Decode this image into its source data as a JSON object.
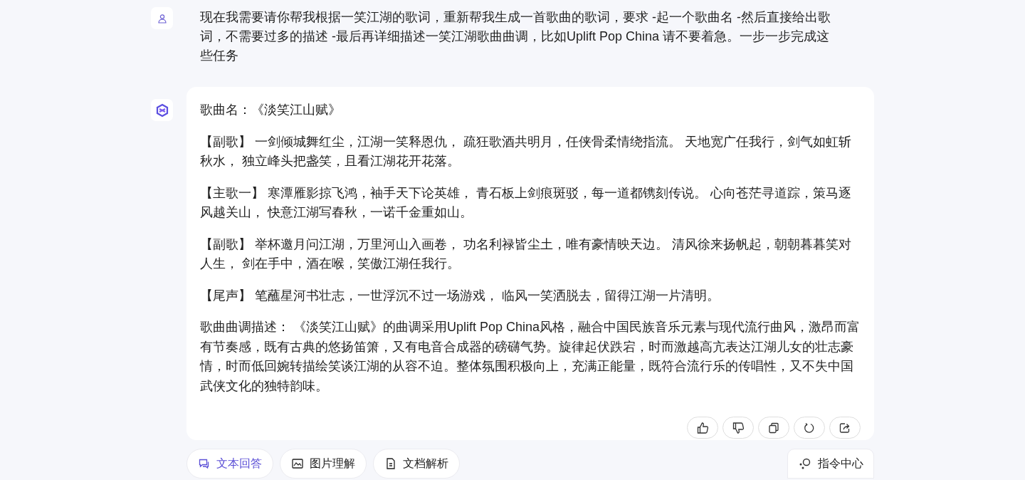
{
  "user_message": {
    "text": "现在我需要请你帮我根据一笑江湖的歌词，重新帮我生成一首歌曲的歌词，要求 -起一个歌曲名 -然后直接给出歌词，不需要过多的描述 -最后再详细描述一笑江湖歌曲曲调，比如Uplift Pop China 请不要着急。一步一步完成这些任务"
  },
  "assistant_message": {
    "paragraphs": [
      "歌曲名：《淡笑江山赋》",
      "【副歌】 一剑倾城舞红尘，江湖一笑释恩仇， 疏狂歌酒共明月，任侠骨柔情绕指流。 天地宽广任我行，剑气如虹斩秋水， 独立峰头把盏笑，且看江湖花开花落。",
      "【主歌一】 寒潭雁影掠飞鸿，袖手天下论英雄， 青石板上剑痕斑驳，每一道都镌刻传说。 心向苍茫寻道踪，策马逐风越关山， 快意江湖写春秋，一诺千金重如山。",
      "【副歌】 举杯邀月问江湖，万里河山入画卷， 功名利禄皆尘土，唯有豪情映天边。 清风徐来扬帆起，朝朝暮暮笑对人生， 剑在手中，酒在喉，笑傲江湖任我行。",
      "【尾声】 笔蘸星河书壮志，一世浮沉不过一场游戏， 临风一笑洒脱去，留得江湖一片清明。",
      "歌曲曲调描述： 《淡笑江山赋》的曲调采用Uplift Pop China风格，融合中国民族音乐元素与现代流行曲风，激昂而富有节奏感，既有古典的悠扬笛箫，又有电音合成器的磅礴气势。旋律起伏跌宕，时而激越高亢表达江湖儿女的壮志豪情，时而低回婉转描绘笑谈江湖的从容不迫。整体氛围积极向上，充满正能量，既符合流行乐的传唱性，又不失中国武侠文化的独特韵味。"
    ],
    "actions": [
      {
        "kind": "like"
      },
      {
        "kind": "dislike"
      },
      {
        "kind": "copy"
      },
      {
        "kind": "regenerate"
      },
      {
        "kind": "share"
      }
    ]
  },
  "tools": [
    {
      "label": "文本回答",
      "kind": "chat",
      "selected": true
    },
    {
      "label": "图片理解",
      "kind": "image",
      "selected": false
    },
    {
      "label": "文档解析",
      "kind": "document",
      "selected": false
    }
  ],
  "command_center": {
    "label": "指令中心"
  }
}
